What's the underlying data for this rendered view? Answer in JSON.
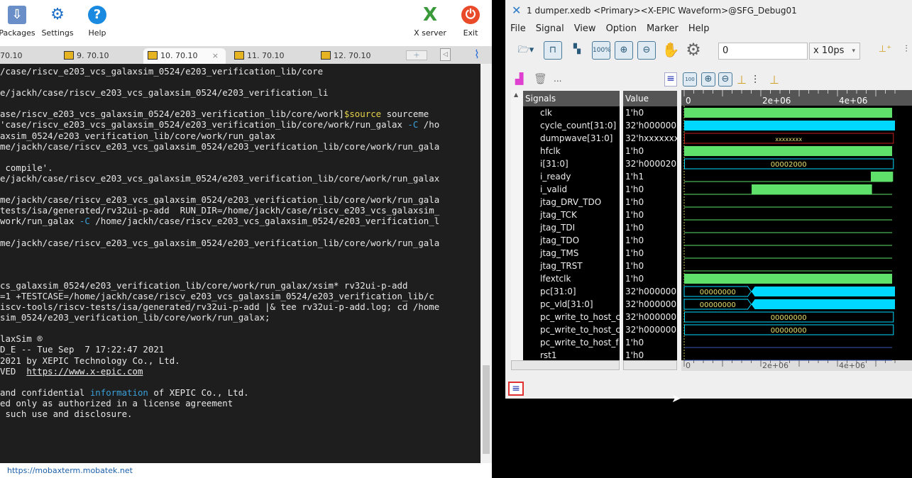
{
  "mobaxterm": {
    "toolbar": [
      {
        "label": "Packages",
        "icon": "packages-icon"
      },
      {
        "label": "Settings",
        "icon": "settings-icon"
      },
      {
        "label": "Help",
        "icon": "help-icon"
      },
      {
        "label": "X server",
        "icon": "x-server-icon"
      },
      {
        "label": "Exit",
        "icon": "exit-icon"
      }
    ],
    "tabs": [
      {
        "label": "70.10",
        "active": false
      },
      {
        "label": "9. 70.10",
        "active": false
      },
      {
        "label": "10. 70.10",
        "active": true
      },
      {
        "label": "11. 70.10",
        "active": false
      },
      {
        "label": "12. 70.10",
        "active": false
      }
    ],
    "tab_close": "×",
    "terminal_lines": [
      [
        [
          "/case/riscv_e203_vcs_galaxsim_0524/e203_verification_lib/core",
          ""
        ]
      ],
      [],
      [
        [
          "e/jackh/case/riscv_e203_vcs_galaxsim_0524/e203_verification_li",
          ""
        ]
      ],
      [],
      [
        [
          "ase/riscv_e203_vcs_galaxsim_0524/e203_verification_lib/core/work]",
          ""
        ],
        [
          "$source",
          "y"
        ],
        [
          " sourceme",
          ""
        ]
      ],
      [
        [
          "'case/riscv_e203_vcs_galaxsim_0524/e203_verification_lib/core/work/run_galax ",
          ""
        ],
        [
          "-C",
          "b"
        ],
        [
          " /ho",
          ""
        ]
      ],
      [
        [
          "axsim_0524/e203_verification_lib/core/work/run_galax",
          ""
        ]
      ],
      [
        [
          "me/jackh/case/riscv_e203_vcs_galaxsim_0524/e203_verification_lib/core/work/run_gala",
          ""
        ]
      ],
      [],
      [
        [
          " compile'.",
          ""
        ]
      ],
      [
        [
          "e/jackh/case/riscv_e203_vcs_galaxsim_0524/e203_verification_lib/core/work/run_galax",
          ""
        ]
      ],
      [],
      [
        [
          "me/jackh/case/riscv_e203_vcs_galaxsim_0524/e203_verification_lib/core/work/run_gala",
          ""
        ]
      ],
      [
        [
          "tests/isa/generated/rv32ui-p-add  RUN_DIR=/home/jackh/case/riscv_e203_vcs_galaxsim_",
          ""
        ]
      ],
      [
        [
          "work/run_galax ",
          ""
        ],
        [
          "-C",
          "b"
        ],
        [
          " /home/jackh/case/riscv_e203_vcs_galaxsim_0524/e203_verification_l",
          ""
        ]
      ],
      [],
      [
        [
          "me/jackh/case/riscv_e203_vcs_galaxsim_0524/e203_verification_lib/core/work/run_gala",
          ""
        ]
      ],
      [],
      [],
      [],
      [
        [
          "cs_galaxsim_0524/e203_verification_lib/core/work/run_galax/xsim* rv32ui-p-add",
          ""
        ]
      ],
      [
        [
          "=1 +TESTCASE=/home/jackh/case/riscv_e203_vcs_galaxsim_0524/e203_verification_lib/c",
          ""
        ]
      ],
      [
        [
          "iscv-tools/riscv-tests/isa/generated/rv32ui-p-add |& tee rv32ui-p-add.log; cd /home",
          ""
        ]
      ],
      [
        [
          "sim_0524/e203_verification_lib/core/work/run_galax;",
          ""
        ]
      ],
      [],
      [
        [
          "laxSim ®",
          ""
        ]
      ],
      [
        [
          "D_E -- Tue Sep  7 17:22:47 2021",
          ""
        ]
      ],
      [
        [
          "2021 by XEPIC Technology Co., Ltd.",
          ""
        ]
      ],
      [
        [
          "VED  ",
          ""
        ],
        [
          "https://www.x-epic.com",
          "u"
        ]
      ],
      [],
      [
        [
          "and confidential ",
          ""
        ],
        [
          "information",
          "b"
        ],
        [
          " of XEPIC Co., Ltd.",
          ""
        ]
      ],
      [
        [
          "ed only as authorized in a license agreement",
          ""
        ]
      ],
      [
        [
          " such use and disclosure.",
          ""
        ]
      ]
    ],
    "status_url": "https://mobaxterm.mobatek.net"
  },
  "waveform": {
    "title": "1 dumper.xedb  <Primary><X-EPIC Waveform>@SFG_Debug01",
    "menu": [
      "File",
      "Signal",
      "View",
      "Option",
      "Marker",
      "Help"
    ],
    "time_value": "0",
    "time_unit": "x 10ps",
    "more": "...",
    "signals_header": "Signals",
    "value_header": "Value",
    "axis_ticks": [
      "0",
      "2e+06",
      "4e+06"
    ],
    "time_end": 5500000,
    "colors": {
      "bit": "#5ee06a",
      "bus": "#00d8ff",
      "x": "#c02020",
      "text": "#e8e070"
    },
    "signals": [
      {
        "name": "clk",
        "value": "1'h0",
        "kind": "clock"
      },
      {
        "name": "cycle_count[31:0]",
        "value": "32'h000000",
        "kind": "busfill",
        "segs": [
          [
            0,
            5500000,
            ""
          ]
        ]
      },
      {
        "name": "dumpwave[31:0]",
        "value": "32'hxxxxxxx",
        "kind": "xbus",
        "segs": [
          [
            0,
            5450000,
            "xxxxxxxx"
          ]
        ]
      },
      {
        "name": "hfclk",
        "value": "1'h0",
        "kind": "clock"
      },
      {
        "name": "i[31:0]",
        "value": "32'h000020",
        "kind": "bus",
        "segs": [
          [
            0,
            5450000,
            "00002000"
          ]
        ]
      },
      {
        "name": "i_ready",
        "value": "1'h1",
        "kind": "bit",
        "high": [
          [
            4870000,
            5450000
          ]
        ]
      },
      {
        "name": "i_valid",
        "value": "1'h0",
        "kind": "bit",
        "high": [
          [
            1760000,
            4900000
          ]
        ]
      },
      {
        "name": "jtag_DRV_TDO",
        "value": "1'h0",
        "kind": "bit",
        "high": []
      },
      {
        "name": "jtag_TCK",
        "value": "1'h0",
        "kind": "bit",
        "high": []
      },
      {
        "name": "jtag_TDI",
        "value": "1'h0",
        "kind": "bit",
        "high": []
      },
      {
        "name": "jtag_TDO",
        "value": "1'h0",
        "kind": "bit",
        "high": []
      },
      {
        "name": "jtag_TMS",
        "value": "1'h0",
        "kind": "bit",
        "high": []
      },
      {
        "name": "jtag_TRST",
        "value": "1'h0",
        "kind": "bit",
        "high": []
      },
      {
        "name": "lfextclk",
        "value": "1'h0",
        "kind": "clock"
      },
      {
        "name": "pc[31:0]",
        "value": "32'h000000",
        "kind": "pc",
        "segs": [
          [
            0,
            1750000,
            "00000000"
          ]
        ]
      },
      {
        "name": "pc_vld[31:0]",
        "value": "32'h000000",
        "kind": "pc",
        "segs": [
          [
            0,
            1750000,
            "00000000"
          ]
        ]
      },
      {
        "name": "pc_write_to_host_c",
        "value": "32'h000000",
        "kind": "bus",
        "segs": [
          [
            0,
            5450000,
            "00000000"
          ]
        ]
      },
      {
        "name": "pc_write_to_host_c",
        "value": "32'h000000",
        "kind": "bus",
        "segs": [
          [
            0,
            5450000,
            "00000000"
          ]
        ]
      },
      {
        "name": "pc_write_to_host_f",
        "value": "1'h0",
        "kind": "bit",
        "high": []
      },
      {
        "name": "rst1",
        "value": "1'h0",
        "kind": "bit",
        "high": []
      }
    ]
  }
}
